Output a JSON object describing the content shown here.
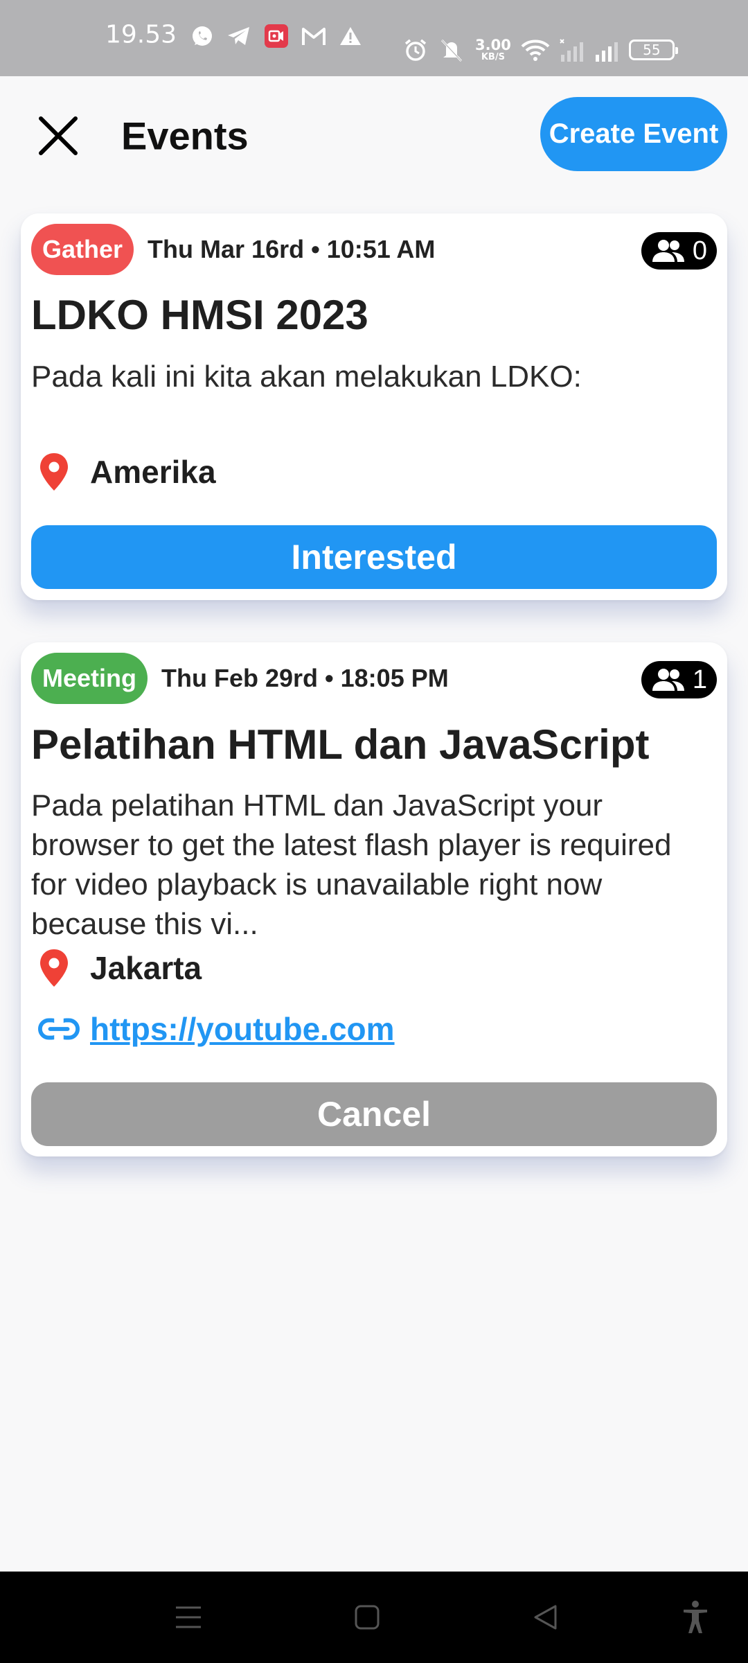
{
  "status_bar": {
    "time": "19.53",
    "net_speed_value": "3.00",
    "net_speed_unit": "KB/S",
    "battery": "55",
    "left_icons": [
      "whatsapp-icon",
      "telegram-icon",
      "screen-recorder-icon",
      "gmail-icon",
      "warning-icon"
    ],
    "right_icons": [
      "alarm-icon",
      "silent-icon",
      "wifi-icon",
      "signal-icon",
      "signal-icon"
    ]
  },
  "header": {
    "title": "Events",
    "create_label": "Create Event"
  },
  "colors": {
    "accent": "#2196f3",
    "gather_tag": "#f05252",
    "meeting_tag": "#4caf50",
    "cancel": "#9e9e9e",
    "location_pin": "#ef4136"
  },
  "events": [
    {
      "tag": "Gather",
      "date": "Thu Mar 16rd • 10:51 AM",
      "attendees": "0",
      "title": "LDKO HMSI 2023",
      "description": "Pada kali ini kita akan melakukan LDKO:",
      "location": "Amerika",
      "action": "Interested"
    },
    {
      "tag": "Meeting",
      "date": "Thu Feb 29rd • 18:05 PM",
      "attendees": "1",
      "title": "Pelatihan HTML dan JavaScript",
      "description": "Pada pelatihan HTML dan JavaScript your browser to get the latest flash player is required for video playback is unavailable right now because this vi...",
      "location": "Jakarta",
      "link": "https://youtube.com",
      "action": "Cancel"
    }
  ],
  "nav_bar": {
    "icons": [
      "menu-icon",
      "home-icon",
      "back-icon",
      "accessibility-icon"
    ]
  }
}
